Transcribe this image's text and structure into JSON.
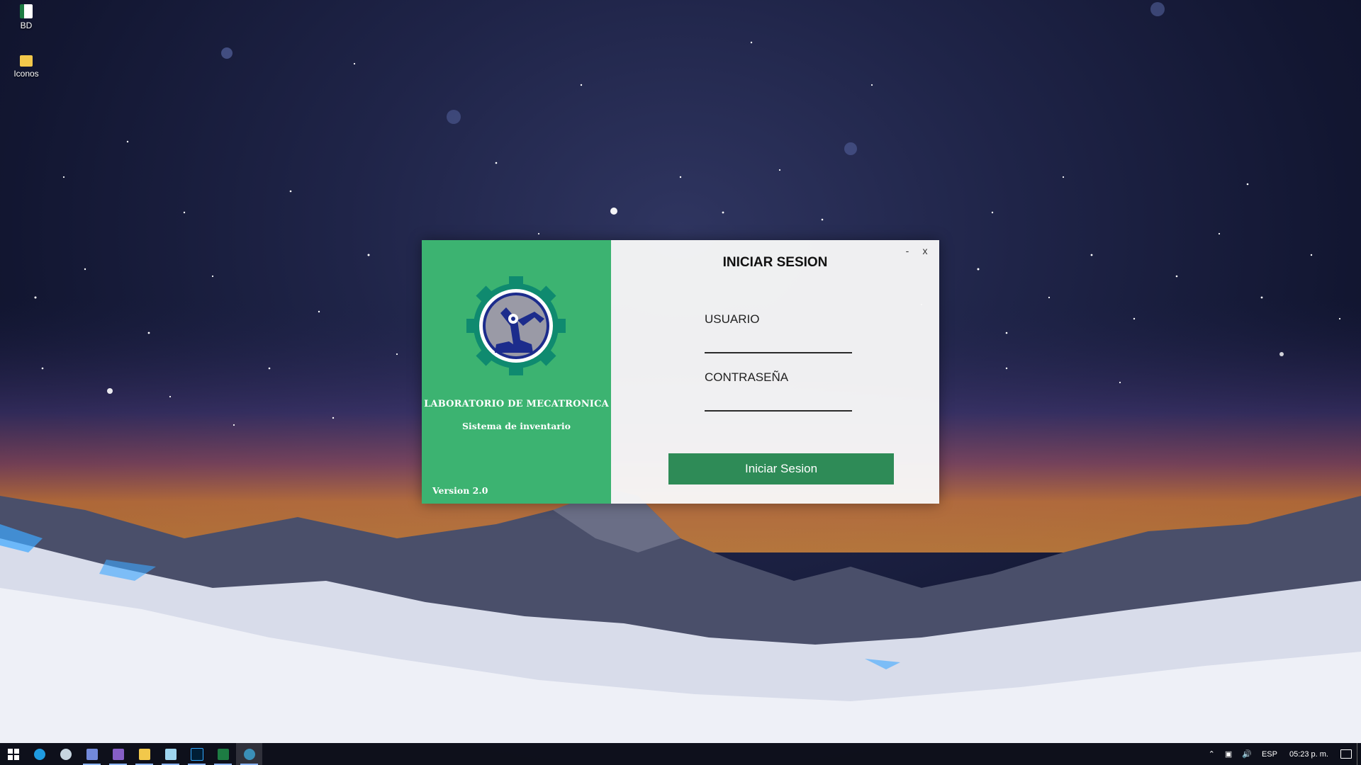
{
  "desktop": {
    "icons": [
      {
        "label": "BD",
        "icon": "excel-file-icon"
      },
      {
        "label": "Iconos",
        "icon": "folder-icon"
      }
    ]
  },
  "login_window": {
    "title": "INICIAR SESION",
    "minimize_label": "-",
    "close_label": "x",
    "brand": {
      "title": "LABORATORIO DE MECATRONICA",
      "subtitle": "Sistema de inventario",
      "version": "Version 2.0",
      "logo_icon": "robot-arm-gear-logo",
      "panel_color": "#3cb371"
    },
    "usuario": {
      "label": "USUARIO",
      "value": ""
    },
    "contrasena": {
      "label": "CONTRASEÑA",
      "value": ""
    },
    "submit_label": "Iniciar Sesion",
    "button_color": "#2e8b57"
  },
  "taskbar": {
    "apps": [
      {
        "name": "start",
        "icon": "windows-icon"
      },
      {
        "name": "edge",
        "icon": "edge-icon"
      },
      {
        "name": "steam",
        "icon": "steam-icon"
      },
      {
        "name": "discord",
        "icon": "discord-icon"
      },
      {
        "name": "visual-studio",
        "icon": "visual-studio-icon"
      },
      {
        "name": "file-explorer",
        "icon": "folder-icon"
      },
      {
        "name": "notepad",
        "icon": "notepad-icon"
      },
      {
        "name": "photoshop",
        "icon": "photoshop-icon"
      },
      {
        "name": "excel",
        "icon": "excel-icon"
      },
      {
        "name": "login-app",
        "icon": "app-icon"
      }
    ],
    "tray": {
      "language": "ESP",
      "time": "05:23 p. m."
    }
  }
}
